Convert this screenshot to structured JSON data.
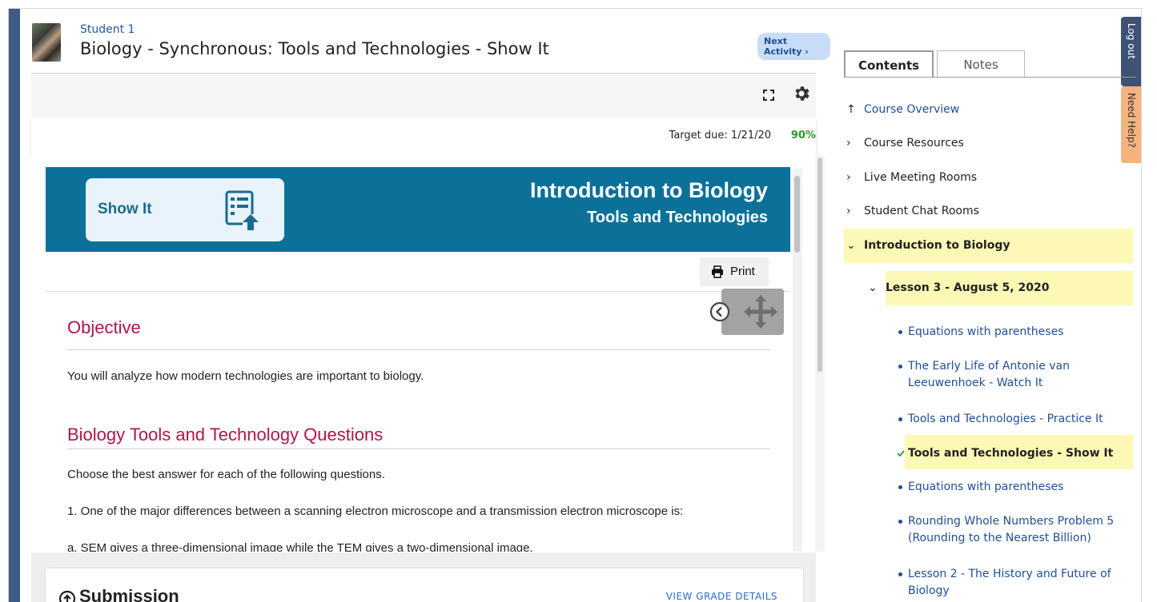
{
  "header": {
    "student_name": "Student 1",
    "activity_title": "Biology - Synchronous: Tools and Technologies - Show It",
    "next_activity_label": "Next Activity ›"
  },
  "status": {
    "target_due": "Target due: 1/21/20",
    "progress_percent": "90%"
  },
  "banner": {
    "tag": "Show It",
    "title": "Introduction to Biology",
    "subtitle": "Tools and Technologies",
    "color": "#0b7199"
  },
  "print_label": "Print",
  "content": {
    "objective_heading": "Objective",
    "objective_text": "You will analyze how modern technologies are important to biology.",
    "questions_heading": "Biology Tools and Technology Questions",
    "instructions": "Choose the best answer for each of the following questions.",
    "question_1": "1. One of the major differences between a scanning electron microscope and a transmission electron microscope is:",
    "answer_a": "a. SEM gives a three-dimensional image while the TEM gives a two-dimensional image."
  },
  "submission": {
    "title": "Submission",
    "grade_link": "VIEW GRADE DETAILS"
  },
  "sidebar": {
    "tabs": [
      "Contents",
      "Notes"
    ],
    "active_tab": "Contents",
    "logout_label": "Log out",
    "help_label": "Need Help?",
    "tree": {
      "course_overview": "Course Overview",
      "course_resources": "Course Resources",
      "live_meeting_rooms": "Live Meeting Rooms",
      "student_chat_rooms": "Student Chat Rooms",
      "intro_biology": "Introduction to Biology",
      "lesson_3": "Lesson 3 - August 5, 2020",
      "items": [
        "Equations with parentheses",
        "The Early Life of Antonie van Leeuwenhoek - Watch It",
        "Tools and Technologies - Practice It",
        "Tools and Technologies - Show It",
        "Equations with parentheses",
        "Rounding Whole Numbers Problem 5 (Rounding to the Nearest Billion)",
        "Lesson 2 - The History and Future of Biology"
      ]
    }
  },
  "colors": {
    "accent_bar": "#3e5a86",
    "heading": "#b4144a",
    "highlight": "#fdf8b6",
    "help_tab": "#f6b27d",
    "logout_tab": "#3e5276"
  }
}
